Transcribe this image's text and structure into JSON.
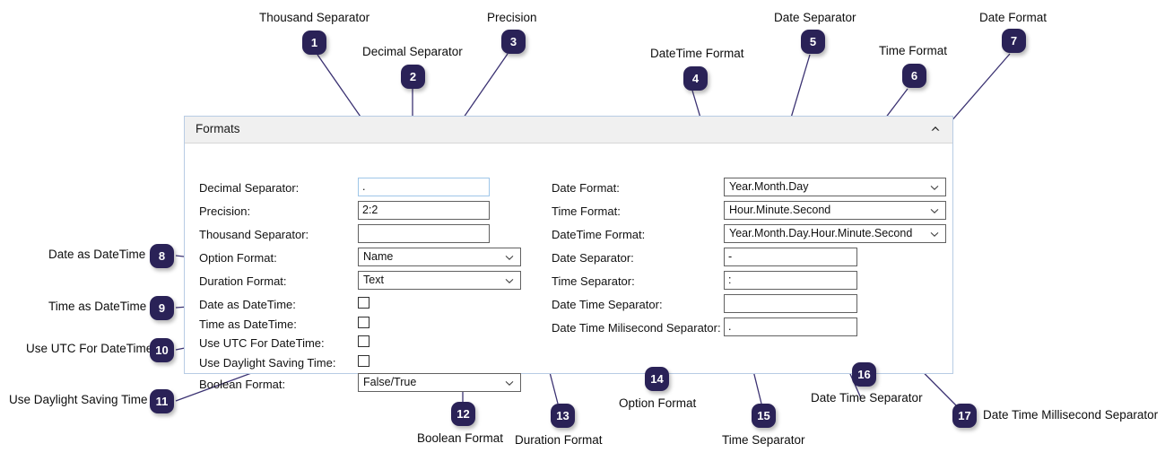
{
  "panel": {
    "title": "Formats",
    "collapse_icon": "chevron-up-icon"
  },
  "left_column": {
    "fields": [
      {
        "label": "Decimal Separator:",
        "type": "text",
        "value": "."
      },
      {
        "label": "Precision:",
        "type": "text",
        "value": "2:2"
      },
      {
        "label": "Thousand Separator:",
        "type": "text",
        "value": ""
      },
      {
        "label": "Option Format:",
        "type": "select",
        "value": "Name"
      },
      {
        "label": "Duration Format:",
        "type": "select",
        "value": "Text"
      },
      {
        "label": "Date as DateTime:",
        "type": "checkbox",
        "value": ""
      },
      {
        "label": "Time as DateTime:",
        "type": "checkbox",
        "value": ""
      },
      {
        "label": "Use UTC For DateTime:",
        "type": "checkbox",
        "value": ""
      },
      {
        "label": "Use Daylight Saving Time:",
        "type": "checkbox",
        "value": ""
      },
      {
        "label": "Boolean Format:",
        "type": "select",
        "value": "False/True"
      }
    ]
  },
  "right_column": {
    "fields": [
      {
        "label": "Date Format:",
        "type": "select",
        "value": "Year.Month.Day"
      },
      {
        "label": "Time Format:",
        "type": "select",
        "value": "Hour.Minute.Second"
      },
      {
        "label": "DateTime Format:",
        "type": "select",
        "value": "Year.Month.Day.Hour.Minute.Second"
      },
      {
        "label": "Date Separator:",
        "type": "text",
        "value": "-"
      },
      {
        "label": "Time Separator:",
        "type": "text",
        "value": ":"
      },
      {
        "label": "Date Time Separator:",
        "type": "text",
        "value": ""
      },
      {
        "label": "Date Time Milisecond Separator:",
        "type": "text",
        "value": "."
      }
    ]
  },
  "callouts": [
    {
      "number": "1",
      "label": "Thousand Separator"
    },
    {
      "number": "2",
      "label": "Decimal Separator"
    },
    {
      "number": "3",
      "label": "Precision"
    },
    {
      "number": "4",
      "label": "DateTime Format"
    },
    {
      "number": "5",
      "label": "Date Separator"
    },
    {
      "number": "6",
      "label": "Time Format"
    },
    {
      "number": "7",
      "label": "Date Format"
    },
    {
      "number": "8",
      "label": "Date as DateTime"
    },
    {
      "number": "9",
      "label": "Time as DateTime"
    },
    {
      "number": "10",
      "label": "Use UTC For DateTime"
    },
    {
      "number": "11",
      "label": "Use Daylight Saving Time"
    },
    {
      "number": "12",
      "label": "Boolean Format"
    },
    {
      "number": "13",
      "label": "Duration Format"
    },
    {
      "number": "14",
      "label": "Option Format"
    },
    {
      "number": "15",
      "label": "Time Separator"
    },
    {
      "number": "16",
      "label": "Date Time Separator"
    },
    {
      "number": "17",
      "label": "Date Time Millisecond Separator"
    }
  ],
  "colors": {
    "badge": "#2a2257",
    "connector": "#3b3272",
    "panel_border": "#b8cce4",
    "panel_header": "#f0f0f0",
    "field_border": "#616161",
    "focus_border": "#9fc6e8"
  }
}
